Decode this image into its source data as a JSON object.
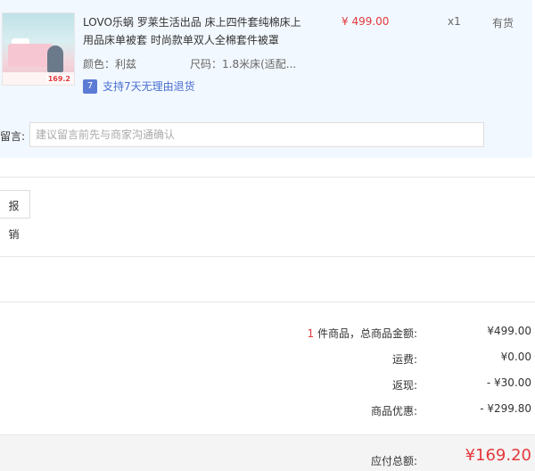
{
  "product": {
    "title": "LOVO乐蜗 罗莱生活出品 床上四件套纯棉床上用品床单被套 时尚款单双人全棉套件被罩",
    "price": "¥ 499.00",
    "quantity": "x1",
    "stock": "有货",
    "color_label": "颜色：利兹",
    "size_label": "尺码：1.8米床(适配...",
    "return_badge": "7",
    "return_text": "支持7天无理由退货",
    "thumb_price": "169.2"
  },
  "note": {
    "label": "留言:",
    "placeholder": "建议留言前先与商家沟通确认"
  },
  "invoice": {
    "button": "报销"
  },
  "summary": {
    "count": "1",
    "count_suffix": " 件商品，总商品金额:",
    "goods_total": "¥499.00",
    "shipping_label": "运费:",
    "shipping_value": "¥0.00",
    "cashback_label": "返现:",
    "cashback_value": "- ¥30.00",
    "discount_label": "商品优惠:",
    "discount_value": "- ¥299.80",
    "payable_label": "应付总额:",
    "payable_value": "¥169.20"
  },
  "colors": {
    "accent": "#e4393c",
    "panel": "#f2f8ff",
    "link": "#4a6fd1"
  }
}
